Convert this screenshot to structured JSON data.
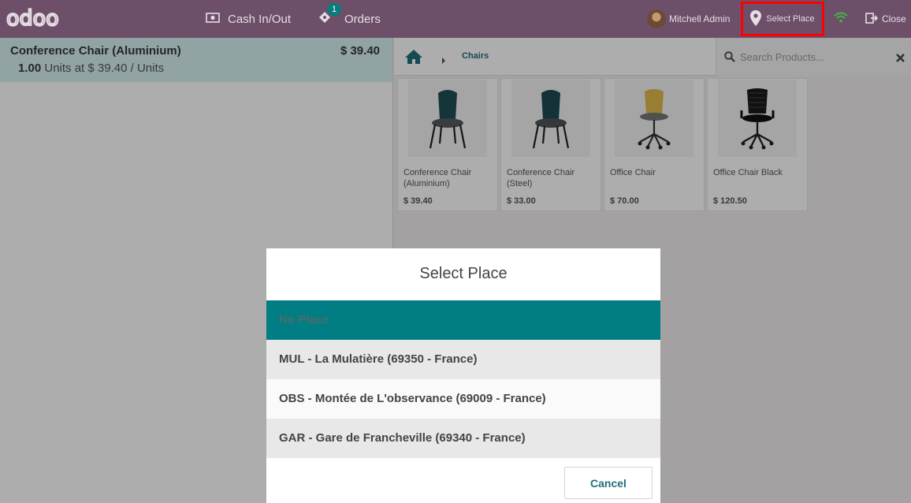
{
  "header": {
    "logo": "odoo",
    "cash_label": "Cash In/Out",
    "orders_label": "Orders",
    "orders_count": "1",
    "user_name": "Mitchell Admin",
    "place_label": "Select Place",
    "close_label": "Close"
  },
  "order": {
    "lines": [
      {
        "name": "Conference Chair (Aluminium)",
        "price": "$ 39.40",
        "qty": "1.00",
        "unit_text": "Units at $ 39.40 / Units"
      }
    ]
  },
  "products": {
    "breadcrumb": "Chairs",
    "search_placeholder": "Search Products...",
    "items": [
      {
        "name": "Conference Chair (Aluminium)",
        "price": "$ 39.40"
      },
      {
        "name": "Conference Chair (Steel)",
        "price": "$ 33.00"
      },
      {
        "name": "Office Chair",
        "price": "$ 70.00"
      },
      {
        "name": "Office Chair Black",
        "price": "$ 120.50"
      }
    ]
  },
  "dialog": {
    "title": "Select Place",
    "options": [
      "No Place",
      "MUL - La Mulatière (69350 - France)",
      "OBS - Montée de L'observance (69009 - France)",
      "GAR - Gare de Francheville (69340 - France)"
    ],
    "cancel_label": "Cancel"
  },
  "colors": {
    "header_bg": "#6d4f6a",
    "accent": "#017e84",
    "selected_line_bg": "#d6f2f1",
    "highlight_border": "#ff0000"
  }
}
